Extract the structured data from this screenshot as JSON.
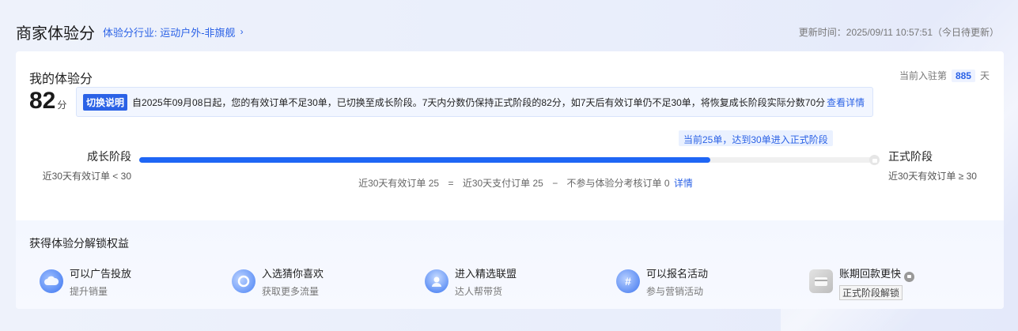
{
  "header": {
    "title": "商家体验分",
    "industry_link": "体验分行业: 运动户外-非旗舰",
    "update_time": "更新时间：2025/09/11 10:57:51（今日待更新）"
  },
  "score_section": {
    "title": "我的体验分",
    "days_prefix": "当前入驻第",
    "days_value": "885",
    "days_suffix": "天",
    "score_value": "82",
    "score_unit": "分"
  },
  "notice": {
    "tag": "切换说明",
    "text": "自2025年09月08日起，您的有效订单不足30单，已切换至成长阶段。7天内分数仍保持正式阶段的82分，如7天后有效订单仍不足30单，将恢复成长阶段实际分数70分",
    "link": "查看详情"
  },
  "progress": {
    "left_stage": "成长阶段",
    "left_condition": "近30天有效订单 < 30",
    "right_stage": "正式阶段",
    "right_condition": "近30天有效订单 ≥ 30",
    "tooltip": "当前25单，达到30单进入正式阶段",
    "current": 25,
    "target": 30,
    "formula": {
      "a": "近30天有效订单 25",
      "eq": "=",
      "b": "近30天支付订单 25",
      "minus": "−",
      "c": "不参与体验分考核订单 0",
      "link": "详情"
    }
  },
  "benefits": {
    "title": "获得体验分解锁权益",
    "items": [
      {
        "title": "可以广告投放",
        "sub": "提升销量",
        "icon": "ad-cloud-icon"
      },
      {
        "title": "入选猜你喜欢",
        "sub": "获取更多流量",
        "icon": "recommend-icon"
      },
      {
        "title": "进入精选联盟",
        "sub": "达人帮带货",
        "icon": "influencer-icon"
      },
      {
        "title": "可以报名活动",
        "sub": "参与营销活动",
        "icon": "activity-hashtag-icon"
      },
      {
        "title": "账期回款更快",
        "sub": "正式阶段解锁",
        "icon": "wallet-card-icon",
        "locked": true
      }
    ]
  },
  "colors": {
    "accent": "#2b62e6",
    "progress_fill": "#1f66f5"
  }
}
